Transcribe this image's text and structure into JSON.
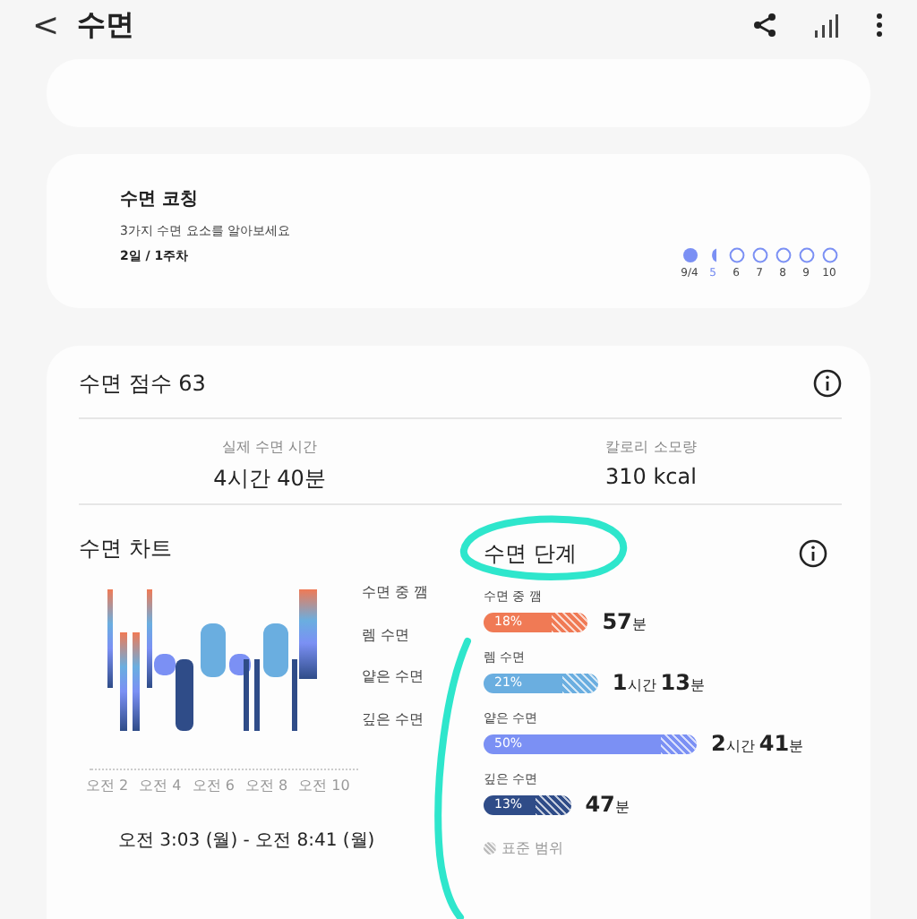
{
  "header": {
    "back": "<",
    "title": "수면"
  },
  "coaching": {
    "title": "수면 코칭",
    "subtitle": "3가지 수면 요소를 알아보세요",
    "progress": "2일 / 1주차",
    "days": [
      {
        "label": "9/4",
        "kind": "done",
        "selected": false
      },
      {
        "label": "5",
        "kind": "half",
        "selected": true
      },
      {
        "label": "6",
        "kind": "empty",
        "selected": false
      },
      {
        "label": "7",
        "kind": "empty",
        "selected": false
      },
      {
        "label": "8",
        "kind": "empty",
        "selected": false
      },
      {
        "label": "9",
        "kind": "empty",
        "selected": false
      },
      {
        "label": "10",
        "kind": "empty",
        "selected": false
      }
    ]
  },
  "score": {
    "title": "수면 점수 63",
    "stats": [
      {
        "label": "실제 수면 시간",
        "value": "4시간 40분"
      },
      {
        "label": "칼로리 소모량",
        "value": "310 kcal"
      }
    ]
  },
  "chart": {
    "title": "수면 차트",
    "stages": [
      "수면 중 깸",
      "렘 수면",
      "얕은 수면",
      "깊은 수면"
    ],
    "xticks": [
      "오전 2",
      "오전 4",
      "오전 6",
      "오전 8",
      "오전 10"
    ],
    "range": "오전 3:03 (월) - 오전 8:41 (월)"
  },
  "stages": {
    "title": "수면 단계",
    "items": [
      {
        "label": "수면 중 깸",
        "percent": "18%",
        "color": "#f07a55",
        "duration": "**57**분"
      },
      {
        "label": "렘 수면",
        "percent": "21%",
        "color": "#6aaee0",
        "duration": "**1**시간 **13**분"
      },
      {
        "label": "얕은 수면",
        "percent": "50%",
        "color": "#7b90f4",
        "duration": "**2**시간 **41**분"
      },
      {
        "label": "깊은 수면",
        "percent": "13%",
        "color": "#2f4c88",
        "duration": "**47**분"
      }
    ],
    "legend": "표준 범위"
  }
}
